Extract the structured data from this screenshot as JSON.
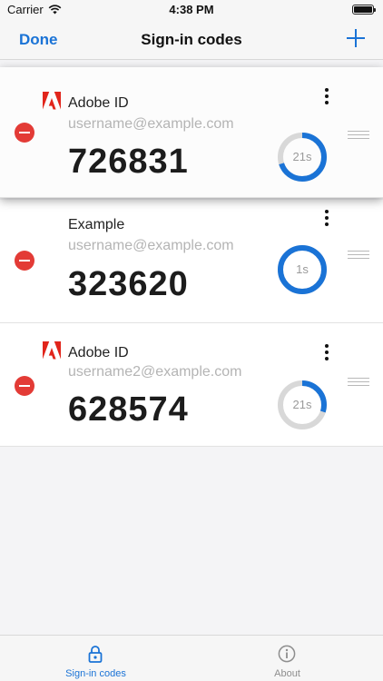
{
  "status_bar": {
    "carrier": "Carrier",
    "time": "4:38 PM"
  },
  "nav": {
    "done_label": "Done",
    "title": "Sign-in codes",
    "add_icon": "plus-icon"
  },
  "accounts": [
    {
      "issuer": "Adobe ID",
      "account": "username@example.com",
      "code": "726831",
      "timer_label": "21s",
      "timer_remaining": 0.7,
      "has_logo": true
    },
    {
      "issuer": "Example",
      "account": "username@example.com",
      "code": "323620",
      "timer_label": "1s",
      "timer_remaining": 1.0,
      "has_logo": false
    },
    {
      "issuer": "Adobe ID",
      "account": "username2@example.com",
      "code": "628574",
      "timer_label": "21s",
      "timer_remaining": 0.3,
      "has_logo": true
    }
  ],
  "tabs": [
    {
      "label": "Sign-in codes",
      "icon": "lock-icon",
      "active": true
    },
    {
      "label": "About",
      "icon": "info-icon",
      "active": false
    }
  ],
  "colors": {
    "accent": "#1a73d6",
    "delete": "#e33b36",
    "adobe_red": "#e1251b",
    "ring_track": "#d8d8d8"
  }
}
